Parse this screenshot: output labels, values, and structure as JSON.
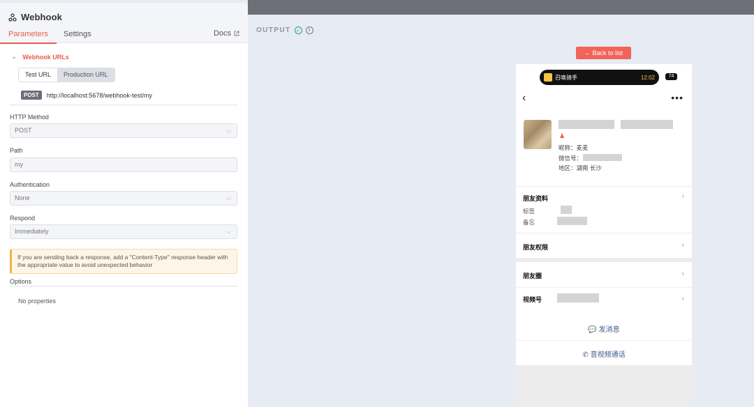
{
  "panel": {
    "title": "Webhook",
    "tabs": [
      "Parameters",
      "Settings"
    ],
    "docs_label": "Docs",
    "webhook_urls_label": "Webhook URLs",
    "url_modes": [
      "Test URL",
      "Production URL"
    ],
    "method_badge": "POST",
    "url": "http://localhost:5678/webhook-test/my",
    "fields": {
      "http_method": {
        "label": "HTTP Method",
        "value": "POST"
      },
      "path": {
        "label": "Path",
        "value": "my"
      },
      "authentication": {
        "label": "Authentication",
        "value": "None"
      },
      "respond": {
        "label": "Respond",
        "value": "Immediately"
      }
    },
    "notice": "If you are sending back a response, add a \"Content-Type\" response header with the appropriate value to avoid unexpected behavior",
    "options_label": "Options",
    "no_properties": "No properties"
  },
  "output": {
    "label": "OUTPUT",
    "back_button": "← Back to list"
  },
  "phone": {
    "island_app": "召唤骑手",
    "island_time": "12:02",
    "battery": "74",
    "nickname": "昵称：麦麦",
    "wechat_id": "微信号：",
    "region": "地区：湖南 长沙",
    "friend_profile": "朋友资料",
    "tag_label": "标签",
    "memo_label": "备忘",
    "friend_permissions": "朋友权限",
    "moments": "朋友圈",
    "channels": "视频号",
    "send_message": "发消息",
    "av_call": "音视频通话"
  },
  "colors": {
    "accent": "#ea5c4a",
    "back_button": "#f0645a",
    "success": "#25a366",
    "link_blue": "#3e5a8c"
  }
}
